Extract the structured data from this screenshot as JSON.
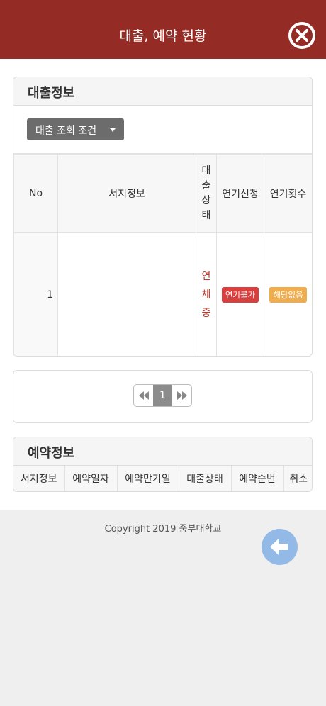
{
  "header": {
    "title": "대출, 예약 현황",
    "close_icon": "close-circle-icon"
  },
  "loan": {
    "heading": "대출정보",
    "filter_label": "대출 조회 조건",
    "columns": {
      "no": "No",
      "book": "서지정보",
      "status_lines": [
        "대",
        "출",
        "상",
        "태"
      ],
      "extend_request": "연기신청",
      "extend_count": "연기횟수"
    },
    "rows": [
      {
        "no": "1",
        "book": "",
        "status_lines": [
          "연",
          "체",
          "중"
        ],
        "extend_request_badge": "연기불가",
        "extend_count_badge": "해당없음"
      }
    ]
  },
  "pagination": {
    "current": "1",
    "prev_icon": "double-chevron-left-icon",
    "next_icon": "double-chevron-right-icon"
  },
  "reservation": {
    "heading": "예약정보",
    "columns": [
      "서지정보",
      "예약일자",
      "예약만기일",
      "대출상태",
      "예약순번",
      "취소"
    ]
  },
  "footer": {
    "copyright": "Copyright 2019 중부대학교",
    "back_icon": "arrow-left-icon"
  },
  "colors": {
    "header_bg": "#952b25",
    "overdue_text": "#c0392b",
    "badge_red": "#d84040",
    "badge_orange": "#efad4e",
    "back_button": "#93b9e7"
  }
}
